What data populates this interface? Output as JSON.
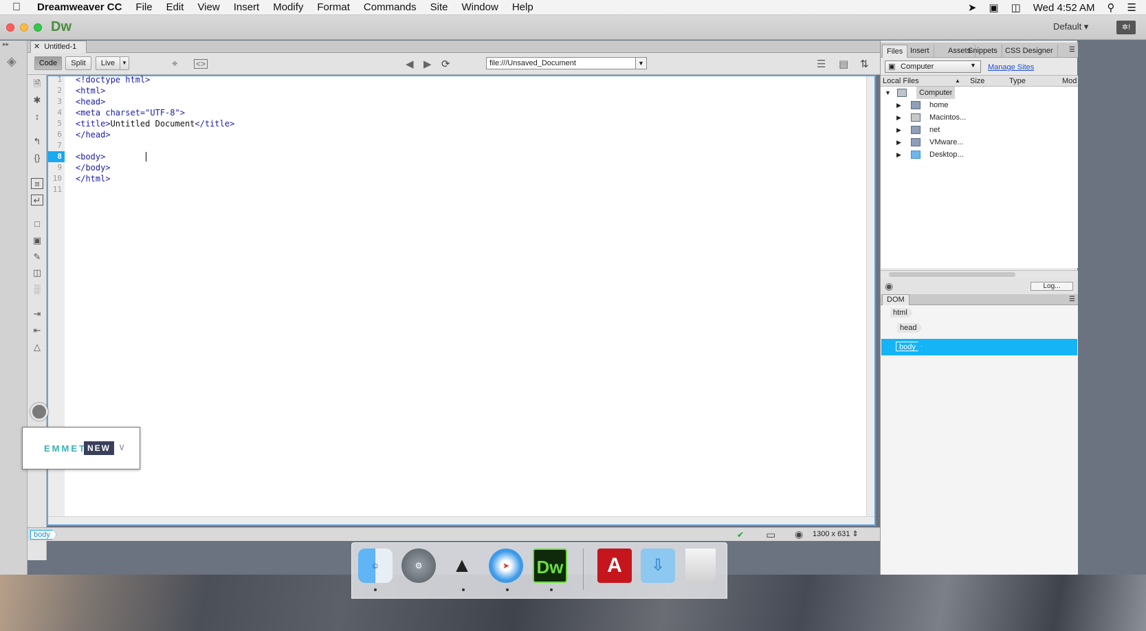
{
  "menubar": {
    "app_name": "Dreamweaver CC",
    "items": [
      "File",
      "Edit",
      "View",
      "Insert",
      "Modify",
      "Format",
      "Commands",
      "Site",
      "Window",
      "Help"
    ],
    "clock": "Wed 4:52 AM"
  },
  "titlebar": {
    "logo": "Dw",
    "workspace": "Default ▾",
    "sync_label": "✲!"
  },
  "document": {
    "tab_title": "Untitled-1",
    "view_buttons": {
      "code": "Code",
      "split": "Split",
      "live": "Live"
    },
    "url": "file:///Unsaved_Document",
    "active_view": "Code"
  },
  "code": {
    "active_line": 8,
    "lines": [
      {
        "n": "1",
        "text": "<!doctype html>"
      },
      {
        "n": "2",
        "text": "<html>"
      },
      {
        "n": "3",
        "text": "<head>"
      },
      {
        "n": "4",
        "text": "<meta charset=\"UTF-8\">"
      },
      {
        "n": "5",
        "pre": "<title>",
        "mid": "Untitled Document",
        "post": "</title>"
      },
      {
        "n": "6",
        "text": "</head>"
      },
      {
        "n": "7",
        "text": ""
      },
      {
        "n": "8",
        "text": "<body>"
      },
      {
        "n": "9",
        "text": "</body>"
      },
      {
        "n": "10",
        "text": "</html>"
      },
      {
        "n": "11",
        "text": ""
      }
    ]
  },
  "statusbar": {
    "tag": "body",
    "window_size": "1300 x 631 ⇕"
  },
  "emmet": {
    "label": "EMMET",
    "badge": "NEW"
  },
  "files_panel": {
    "tabs": [
      "Files",
      "Insert",
      "Assets",
      "Snippets",
      "CSS Designer"
    ],
    "active_tab": "Files",
    "site": "Computer",
    "manage_sites": "Manage Sites",
    "columns": {
      "local": "Local Files",
      "size": "Size",
      "type": "Type",
      "mod": "Mod"
    },
    "root": "Computer",
    "items": [
      "home",
      "Macintos...",
      "net",
      "VMware...",
      "Desktop..."
    ],
    "log_button": "Log..."
  },
  "dom_panel": {
    "title": "DOM",
    "nodes": {
      "html": "html",
      "head": "head",
      "body": "body"
    },
    "selected": "body"
  },
  "dock": {
    "apps": [
      "finder-icon",
      "system-preferences-icon",
      "screenshot-app-icon",
      "safari-icon",
      "dreamweaver-icon",
      "acrobat-icon",
      "downloads-folder-icon",
      "trash-icon"
    ],
    "dw_label": "Dw",
    "acrobat_label": "A"
  },
  "colors": {
    "accent": "#17a9f1",
    "dw_green": "#4a8d3f",
    "code_tag": "#1a1aa6"
  }
}
